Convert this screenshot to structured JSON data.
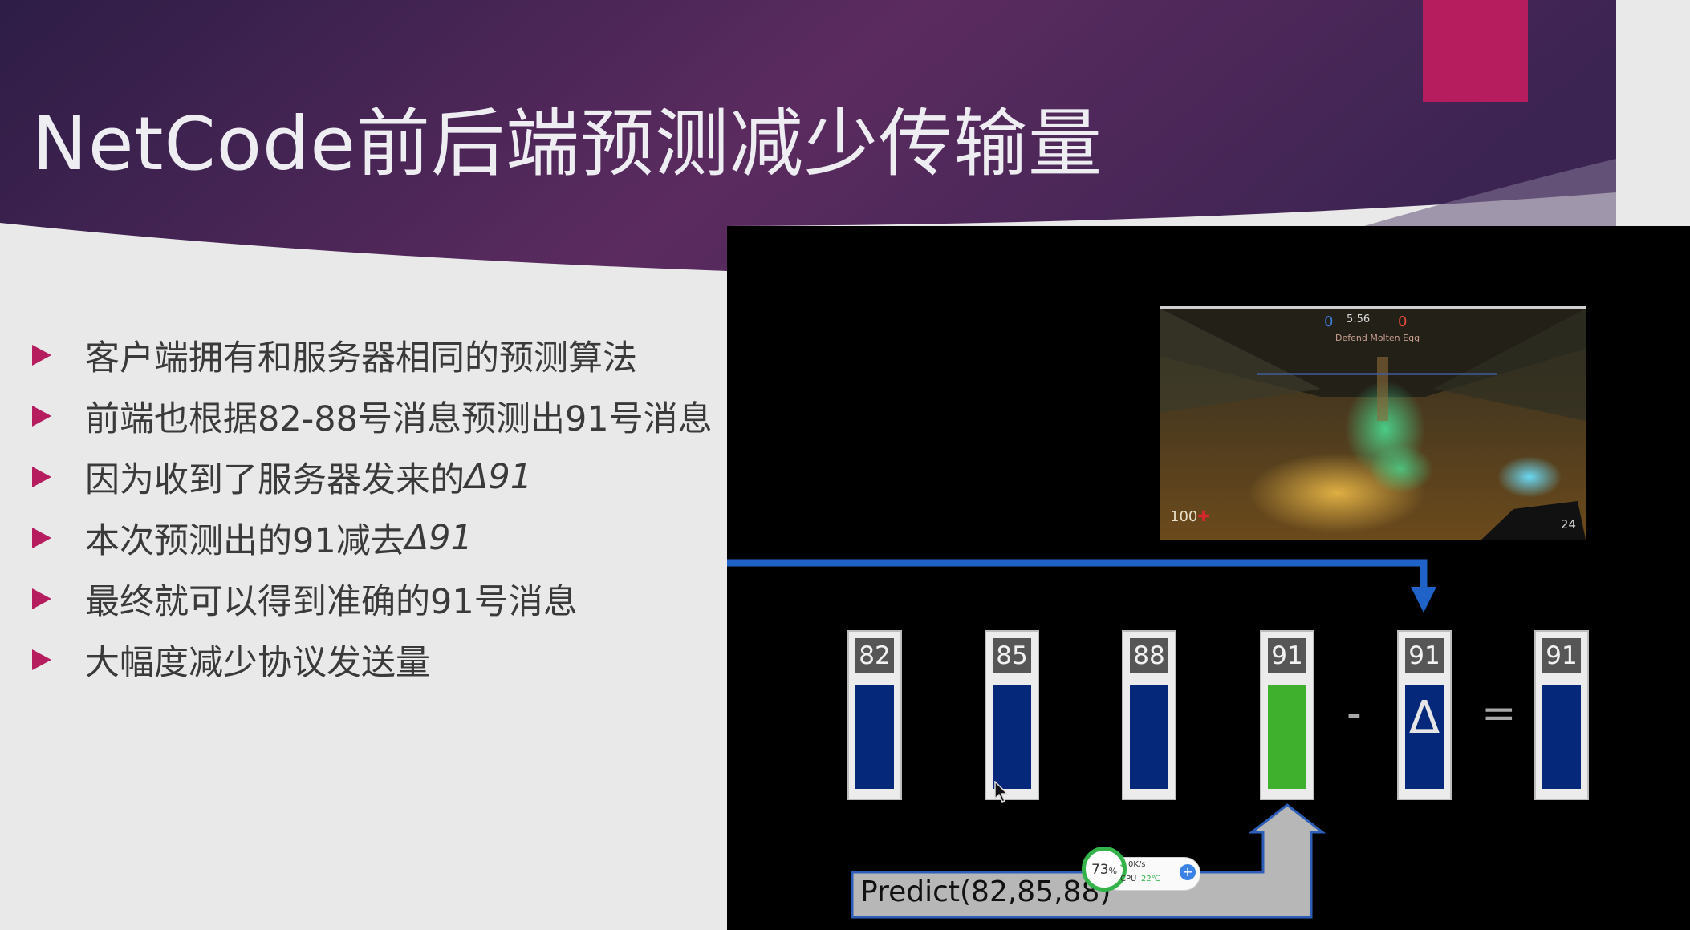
{
  "slide": {
    "title": "NetCode前后端预测减少传输量",
    "bullets": [
      {
        "text": "客户端拥有和服务器相同的预测算法"
      },
      {
        "text": "前端也根据82-88号消息预测出91号消息"
      },
      {
        "text": "因为收到了服务器发来的",
        "italic": "Δ91"
      },
      {
        "text": "本次预测出的91减去",
        "italic": "Δ91"
      },
      {
        "text": "最终就可以得到准确的91号消息"
      },
      {
        "text": "大幅度减少协议发送量"
      }
    ]
  },
  "video": {
    "game": {
      "timer": "5:56",
      "score_left": "0",
      "score_right": "0",
      "objective": "Defend Molten Egg",
      "health": "100",
      "ammo": "24"
    },
    "messages": [
      {
        "label": "82",
        "fill": "#06287a"
      },
      {
        "label": "85",
        "fill": "#06287a"
      },
      {
        "label": "88",
        "fill": "#06287a"
      },
      {
        "label": "91",
        "fill": "#3fb02e"
      },
      {
        "label": "91",
        "fill": "#06287a",
        "symbol": "Δ"
      },
      {
        "label": "91",
        "fill": "#06287a"
      }
    ],
    "operators": {
      "minus": "-",
      "equals": "="
    },
    "predict_label": "Predict(82,85,88)",
    "colors": {
      "arrow": "#1f63c8",
      "predict_arrow": "#b7b7b7",
      "predict_outline": "#2d5fb8"
    }
  },
  "system_widget": {
    "percent": "73",
    "percent_unit": "%",
    "net_speed": "0K/s",
    "cpu_label": "CPU",
    "cpu_temp": "22℃"
  },
  "colors": {
    "accent": "#b61d5e",
    "banner_dark": "#2e1f47",
    "banner_mid": "#5a2c5e",
    "body_bg": "#e9e9e9"
  }
}
